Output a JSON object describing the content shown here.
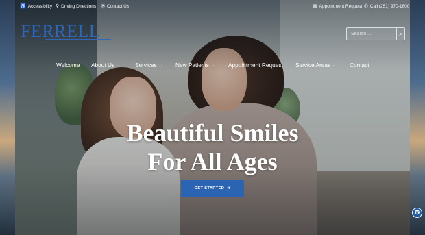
{
  "utility_bar": {
    "accessibility": "Accessibility",
    "directions": "Driving Directions",
    "contact": "Contact Us",
    "appointment": "Appointment Request",
    "phone": "Call (251) 970-1600"
  },
  "logo": {
    "name": "FERRELL"
  },
  "search": {
    "placeholder": "Search ..."
  },
  "nav": {
    "items": [
      {
        "label": "Welcome"
      },
      {
        "label": "About Us"
      },
      {
        "label": "Services"
      },
      {
        "label": "New Patients"
      },
      {
        "label": "Appointment Request"
      },
      {
        "label": "Service Areas"
      },
      {
        "label": "Contact"
      }
    ]
  },
  "hero": {
    "line1": "Beautiful Smiles",
    "line2": "For All Ages",
    "cta_label": "GET STARTED"
  },
  "icons": {
    "accessibility": "accessibility-icon",
    "directions": "map-marker-icon",
    "contact": "envelope-icon",
    "appointment": "calendar-icon",
    "phone": "phone-icon",
    "search": "search-icon",
    "cta_arrow": "arrow-right-icon",
    "a11y_widget": "accessibility-widget-icon"
  },
  "colors": {
    "brand_blue": "#2e67b8",
    "cta_blue": "#2a64b3"
  }
}
